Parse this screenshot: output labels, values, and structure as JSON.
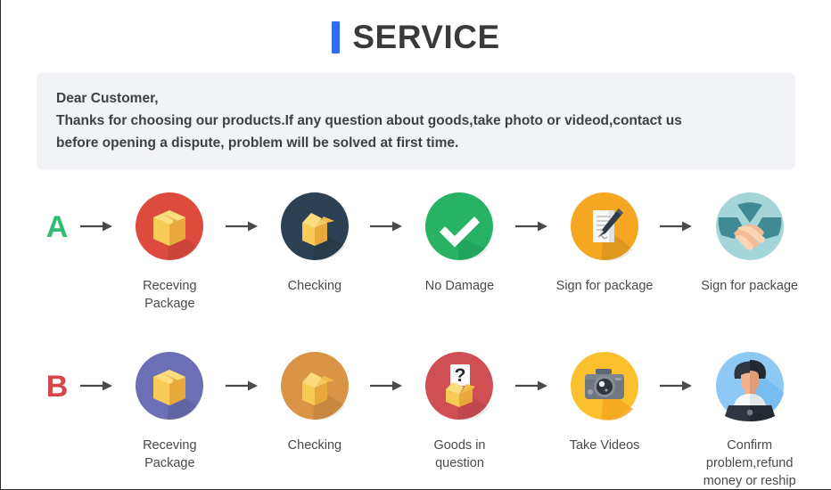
{
  "header": {
    "title": "SERVICE",
    "accent_color": "#2f6df6",
    "title_color": "#3a3a3a"
  },
  "notice": {
    "background_color": "#f2f3f7",
    "text_color": "#3d4044",
    "lines": [
      "Dear Customer,",
      "Thanks for choosing our products.If any question about goods,take photo or videod,contact us",
      "before opening a dispute, problem will be solved at first time."
    ]
  },
  "flows": [
    {
      "letter": "A",
      "letter_color": "#2ebd72",
      "steps": [
        {
          "label": "Receving Package",
          "icon": "closed-box-icon",
          "circle_color": "#dd4b3e"
        },
        {
          "label": "Checking",
          "icon": "open-box-icon",
          "circle_color": "#2c4254"
        },
        {
          "label": "No Damage",
          "icon": "check-mark-icon",
          "circle_color": "#27b264"
        },
        {
          "label": "Sign for package",
          "icon": "document-pen-icon",
          "circle_color": "#f5a623"
        },
        {
          "label": "Sign for package",
          "icon": "handshake-icon",
          "circle_color": "#a4d5d9"
        }
      ]
    },
    {
      "letter": "B",
      "letter_color": "#d8444a",
      "steps": [
        {
          "label": "Receving Package",
          "icon": "closed-box-icon",
          "circle_color": "#6c6fb5"
        },
        {
          "label": "Checking",
          "icon": "open-box-icon",
          "circle_color": "#d99445"
        },
        {
          "label": "Goods in question",
          "icon": "question-box-icon",
          "circle_color": "#cf4f54"
        },
        {
          "label": "Take Videos",
          "icon": "camera-icon",
          "circle_color": "#fbc02d"
        },
        {
          "label": "Confirm problem,refund money or reship",
          "icon": "person-laptop-icon",
          "circle_color": "#8ec9f5"
        }
      ]
    }
  ],
  "arrow": {
    "name": "arrow-right-icon",
    "color": "#4a4a4a"
  }
}
